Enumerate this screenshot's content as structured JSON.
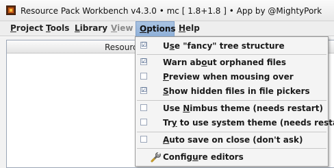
{
  "window": {
    "title": "Resource Pack Workbench v4.3.0  •  mc [ 1.8+1.8 ]  •  App by @MightyPork"
  },
  "menubar": {
    "items": [
      {
        "label_u": "P",
        "label_rest": "roject"
      },
      {
        "label_u": "T",
        "label_rest": "ools"
      },
      {
        "label_u": "L",
        "label_rest": "ibrary"
      },
      {
        "label_u": "V",
        "label_rest": "iew"
      },
      {
        "label_u": "O",
        "label_rest": "ptions"
      },
      {
        "label_u": "H",
        "label_rest": "elp"
      }
    ]
  },
  "panel": {
    "column_header": "Resourc"
  },
  "options_menu": {
    "items": [
      {
        "pre": "U",
        "u": "s",
        "post": "e \"fancy\" tree structure",
        "checked": true,
        "check_glyph": "☑"
      },
      {
        "pre": "Warn ab",
        "u": "o",
        "post": "ut orphaned files",
        "checked": true,
        "check_glyph": "☑"
      },
      {
        "pre": "",
        "u": "P",
        "post": "review when mousing over",
        "checked": false,
        "check_glyph": ""
      },
      {
        "pre": "",
        "u": "S",
        "post": "how hidden files in file pickers",
        "checked": true,
        "check_glyph": "☑"
      },
      {
        "pre": "Use ",
        "u": "N",
        "post": "imbus theme (needs restart)",
        "checked": false,
        "check_glyph": ""
      },
      {
        "pre": "Tr",
        "u": "y",
        "post": " to use system theme (needs restart)",
        "checked": false,
        "check_glyph": ""
      },
      {
        "pre": "",
        "u": "A",
        "post": "uto save on close (don't ask)",
        "checked": false,
        "check_glyph": ""
      },
      {
        "pre": "Config",
        "u": "u",
        "post": "re editors",
        "icon": "wrench-icon"
      }
    ]
  }
}
